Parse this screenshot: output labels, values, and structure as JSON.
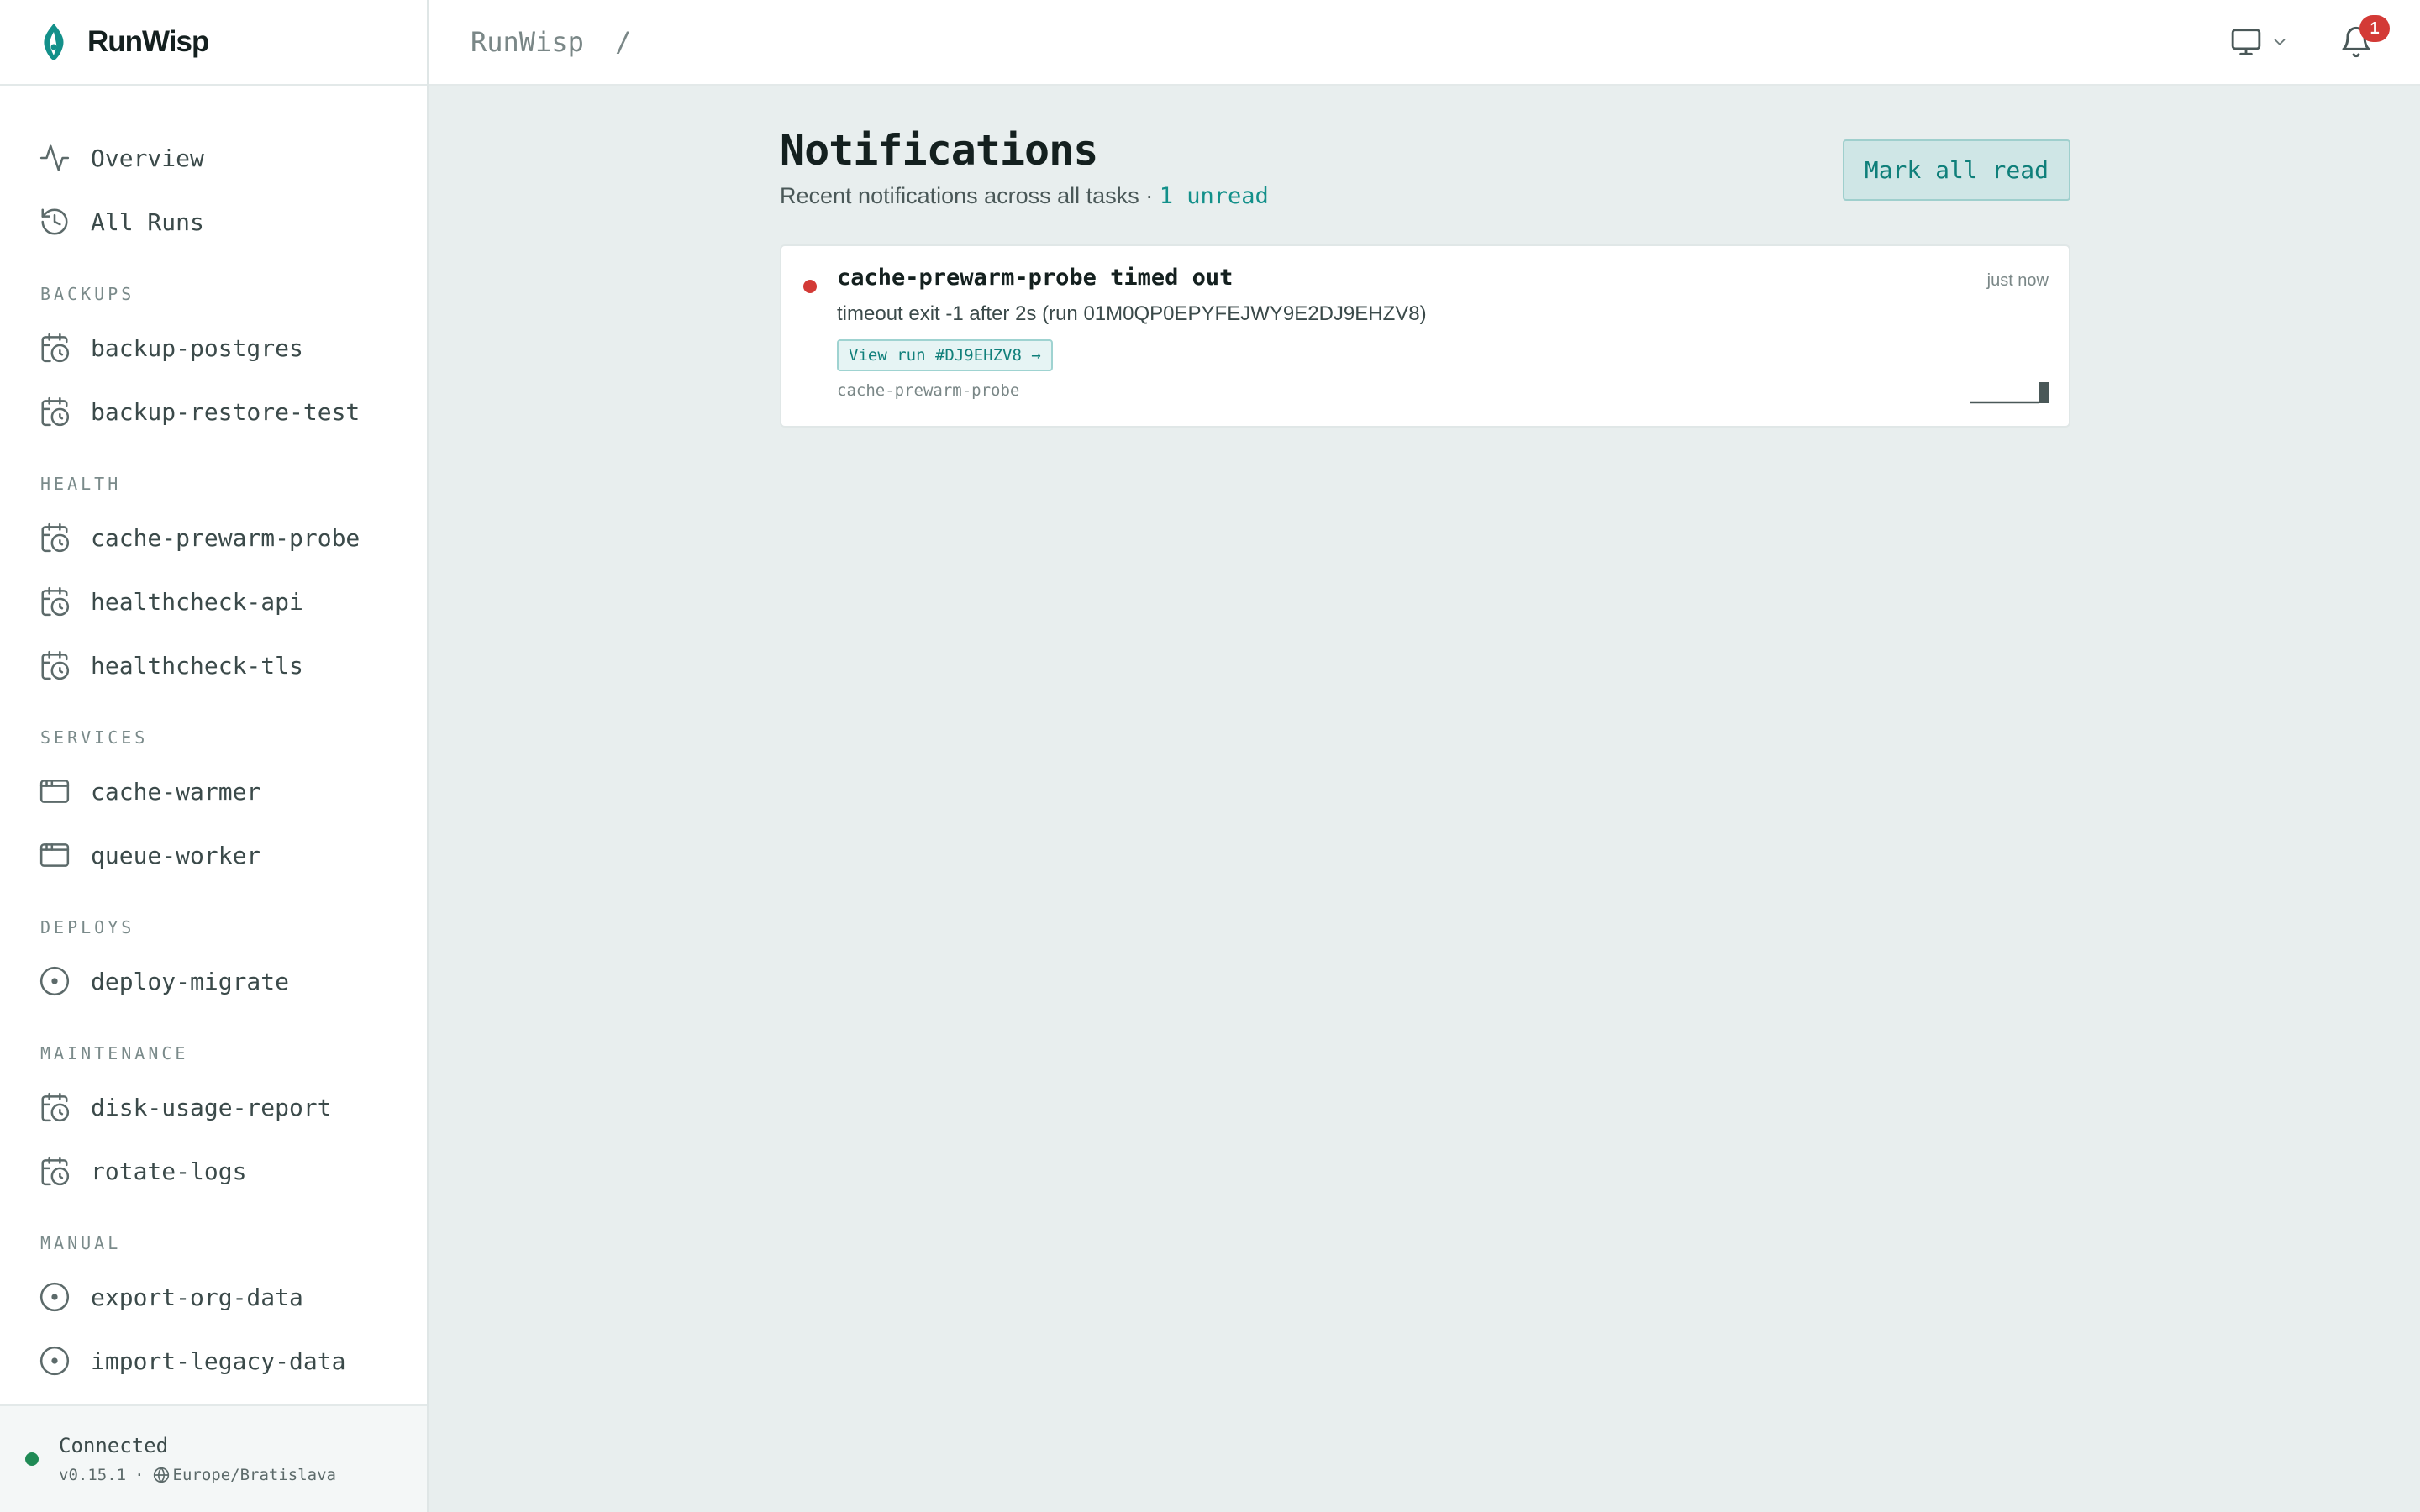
{
  "app": {
    "name": "RunWisp"
  },
  "breadcrumb": {
    "root": "RunWisp",
    "separator": "/"
  },
  "sidebar": {
    "primary": [
      {
        "label": "Overview",
        "icon": "activity-icon"
      },
      {
        "label": "All Runs",
        "icon": "history-icon"
      }
    ],
    "sections": [
      {
        "title": "BACKUPS",
        "items": [
          {
            "label": "backup-postgres",
            "icon": "calendar-clock-icon"
          },
          {
            "label": "backup-restore-test",
            "icon": "calendar-clock-icon"
          }
        ]
      },
      {
        "title": "HEALTH",
        "items": [
          {
            "label": "cache-prewarm-probe",
            "icon": "calendar-clock-icon"
          },
          {
            "label": "healthcheck-api",
            "icon": "calendar-clock-icon"
          },
          {
            "label": "healthcheck-tls",
            "icon": "calendar-clock-icon"
          }
        ]
      },
      {
        "title": "SERVICES",
        "items": [
          {
            "label": "cache-warmer",
            "icon": "app-window-icon"
          },
          {
            "label": "queue-worker",
            "icon": "app-window-icon"
          }
        ]
      },
      {
        "title": "DEPLOYS",
        "items": [
          {
            "label": "deploy-migrate",
            "icon": "circle-dot-icon"
          }
        ]
      },
      {
        "title": "MAINTENANCE",
        "items": [
          {
            "label": "disk-usage-report",
            "icon": "calendar-clock-icon"
          },
          {
            "label": "rotate-logs",
            "icon": "calendar-clock-icon"
          }
        ]
      },
      {
        "title": "MANUAL",
        "items": [
          {
            "label": "export-org-data",
            "icon": "circle-dot-icon"
          },
          {
            "label": "import-legacy-data",
            "icon": "circle-dot-icon"
          }
        ]
      }
    ],
    "footer": {
      "status": "Connected",
      "version": "v0.15.1",
      "separator": "·",
      "timezone": "Europe/Bratislava"
    }
  },
  "topbar": {
    "notification_count": "1"
  },
  "page": {
    "title": "Notifications",
    "subtitle": "Recent notifications across all tasks ·",
    "unread": "1 unread",
    "mark_all_read": "Mark all read"
  },
  "notifications": [
    {
      "title": "cache-prewarm-probe timed out",
      "time": "just now",
      "description": "timeout exit -1 after 2s (run 01M0QP0EPYFEJWY9E2DJ9EHZV8)",
      "action": "View run #DJ9EHZV8 →",
      "task": "cache-prewarm-probe"
    }
  ],
  "colors": {
    "accent": "#13908a",
    "unread_dot": "#d33a36",
    "connected": "#1f8a55",
    "background": "#e8eeee"
  }
}
